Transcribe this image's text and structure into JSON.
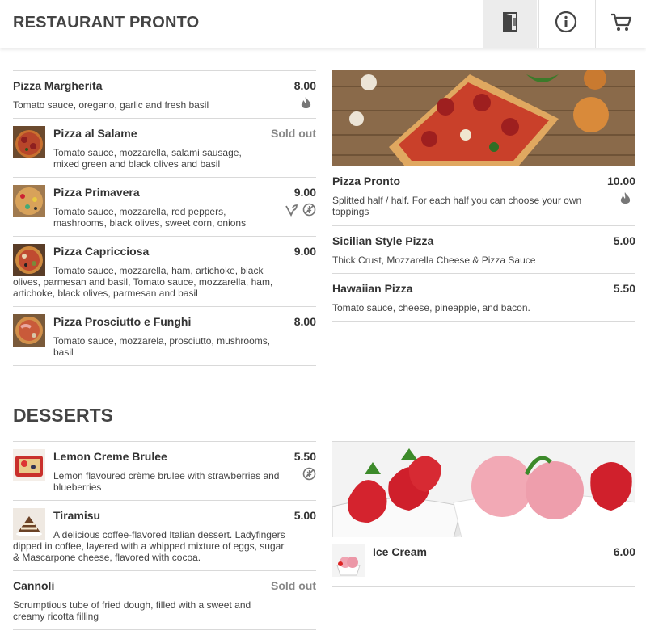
{
  "app": {
    "title": "RESTAURANT PRONTO",
    "icons": [
      "menu-door-icon",
      "info-icon",
      "cart-icon"
    ]
  },
  "pizza_left": [
    {
      "name": "Pizza Margherita",
      "price": "8.00",
      "desc": "Tomato sauce, oregano, garlic and fresh basil",
      "badges": [
        "spicy-icon"
      ]
    },
    {
      "name": "Pizza al Salame",
      "price": "Sold out",
      "desc": "Tomato sauce, mozzarella, salami sausage, mixed green and black olives and basil",
      "badges": []
    },
    {
      "name": "Pizza Primavera",
      "price": "9.00",
      "desc": "Tomato sauce, mozzarella, red peppers, mashrooms, black olives, sweet corn, onions",
      "badges": [
        "vegan-icon",
        "no-gluten-icon"
      ]
    },
    {
      "name": "Pizza Capricciosa",
      "price": "9.00",
      "desc": "Tomato sauce, mozzarella, ham, artichoke, black olives, parmesan and basil, Tomato sauce, mozzarella, ham, artichoke, black olives, parmesan and basil",
      "badges": []
    },
    {
      "name": "Pizza Prosciutto e Funghi",
      "price": "8.00",
      "desc": "Tomato sauce, mozzarela, prosciutto, mushrooms, basil",
      "badges": []
    }
  ],
  "pizza_right": [
    {
      "name": "Pizza Pronto",
      "price": "10.00",
      "desc": "Splitted half / half. For each half you can choose your own toppings",
      "badges": [
        "spicy-icon"
      ]
    },
    {
      "name": "Sicilian Style Pizza",
      "price": "5.00",
      "desc": "Thick Crust, Mozzarella Cheese & Pizza Sauce",
      "badges": []
    },
    {
      "name": "Hawaiian Pizza",
      "price": "5.50",
      "desc": "Tomato sauce, cheese, pineapple, and bacon.",
      "badges": []
    }
  ],
  "desserts": {
    "title": "DESSERTS",
    "left": [
      {
        "name": "Lemon Creme Brulee",
        "price": "5.50",
        "desc": "Lemon flavoured crème brulee with strawberries and blueberries",
        "badges": [
          "no-gluten-icon"
        ]
      },
      {
        "name": "Tiramisu",
        "price": "5.00",
        "desc": "A delicious coffee-flavored Italian dessert. Ladyfingers dipped in coffee, layered with a whipped mixture of eggs, sugar & Mascarpone cheese, flavored with cocoa.",
        "badges": []
      },
      {
        "name": "Cannoli",
        "price": "Sold out",
        "desc": "Scrumptious tube of fried dough, filled with a sweet and creamy ricotta filling",
        "badges": []
      }
    ],
    "right": [
      {
        "name": "Ice Cream",
        "price": "6.00"
      }
    ]
  }
}
